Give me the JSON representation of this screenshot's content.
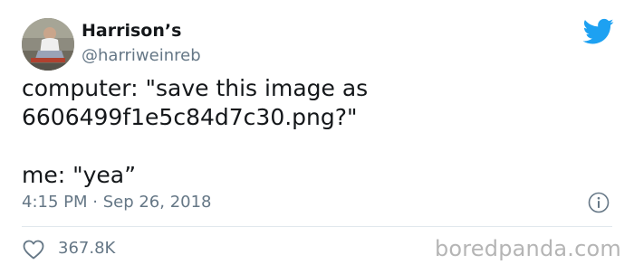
{
  "tweet": {
    "author": {
      "display_name": "Harrison’s",
      "handle": "@harriweinreb"
    },
    "text_lines": [
      "computer: \"save this image as",
      "6606499f1e5c84d7c30.png?\"",
      "",
      "me: \"yea”"
    ],
    "timestamp": "4:15 PM · Sep 26, 2018",
    "likes": "367.8K"
  },
  "icons": {
    "brand": "twitter-bird-icon",
    "info": "info-icon",
    "like": "heart-outline-icon"
  },
  "watermark": "boredpanda.com",
  "colors": {
    "twitter_blue": "#1da1f2",
    "text": "#14171a",
    "secondary_text": "#657786",
    "divider": "#e1e8ed",
    "watermark": "#b5b5b5"
  }
}
